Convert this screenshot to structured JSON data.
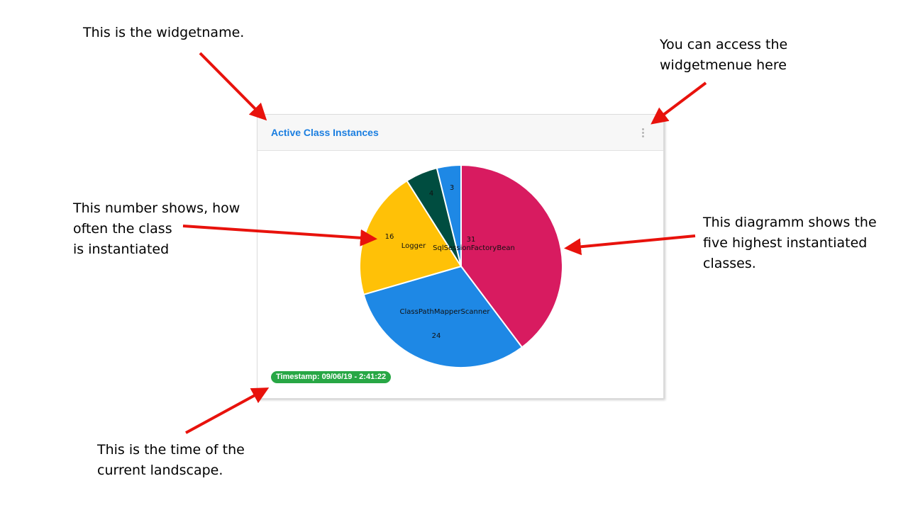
{
  "annotations": {
    "widgetname": "This is the widgetname.",
    "menu": "You can access the\nwidgetmenue here",
    "number": "This number shows, how\noften the class\nis instantiated",
    "diagram": "This diagramm shows the\nfive highest instantiated\nclasses.",
    "time": "This is the time of the\ncurrent landscape."
  },
  "widget": {
    "title": "Active Class Instances",
    "menu_icon": "kebab-vertical-icon",
    "timestamp": "Timestamp: 09/06/19 - 2:41:22"
  },
  "colors": {
    "title": "#1a7ee0",
    "timestamp_bg": "#28a745",
    "arrow": "#e8120c"
  },
  "chart_data": {
    "type": "pie",
    "title": "",
    "slices": [
      {
        "label": "SqlSessionFactoryBean",
        "value": 31,
        "color": "#d81b60"
      },
      {
        "label": "ClassPathMapperScanner",
        "value": 24,
        "color": "#1e88e5"
      },
      {
        "label": "Logger",
        "value": 16,
        "color": "#ffc107"
      },
      {
        "label": "",
        "value": 4,
        "color": "#004d40"
      },
      {
        "label": "",
        "value": 3,
        "color": "#1e88e5"
      }
    ]
  }
}
